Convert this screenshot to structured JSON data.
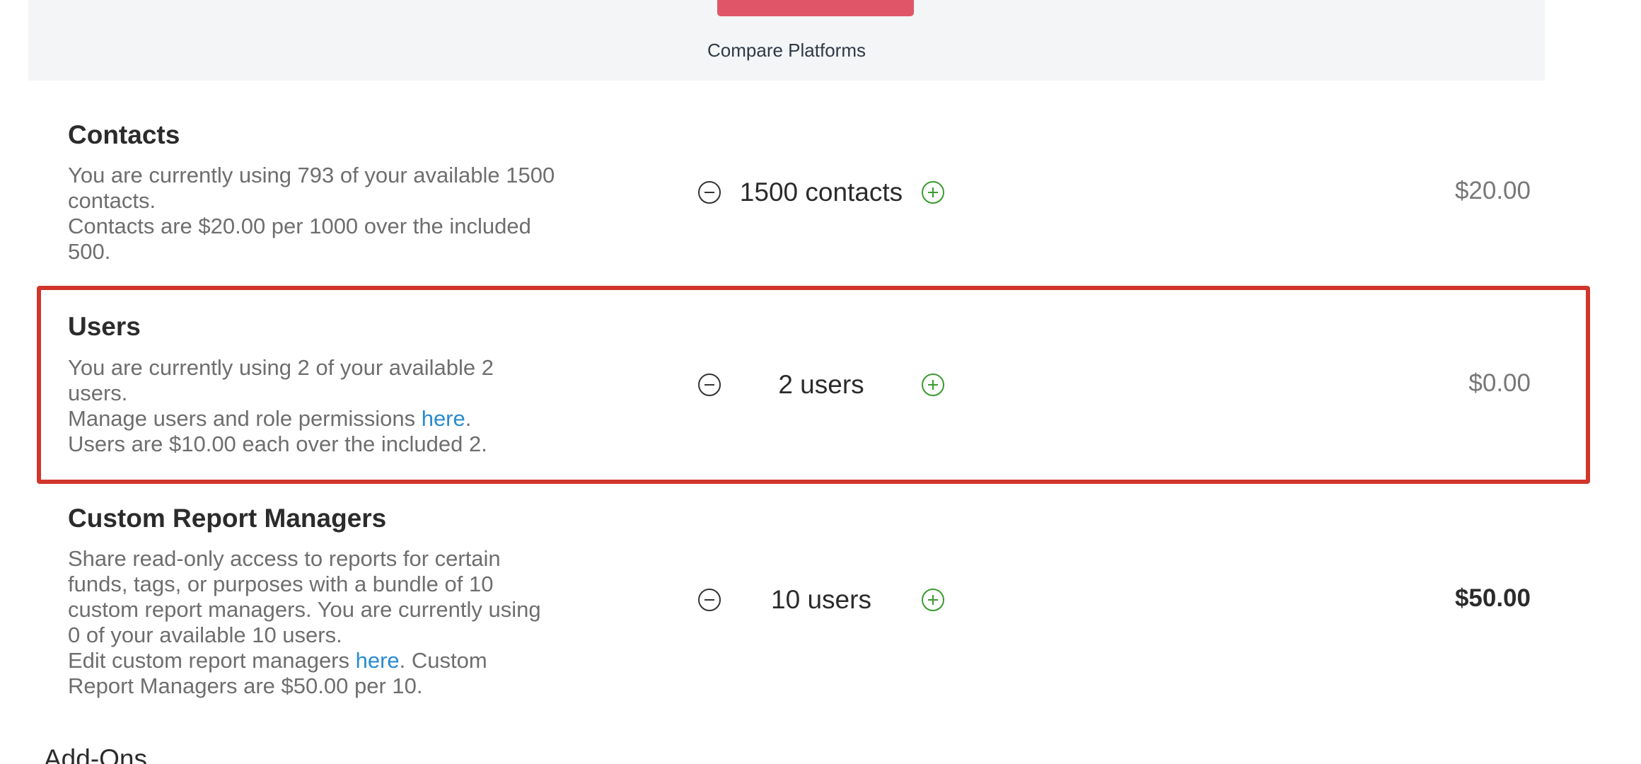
{
  "header": {
    "compare_link": "Compare Platforms"
  },
  "rows": [
    {
      "title": "Contacts",
      "description": [
        "You are currently using 793 of your available 1500 contacts.",
        "Contacts are $20.00 per 1000 over the included 500."
      ],
      "quantity": "1500 contacts",
      "price": "$20.00"
    },
    {
      "title": "Users",
      "description_line1": "You are currently using 2 of your available 2 users.",
      "description_line2_prefix": "Manage users and role permissions ",
      "description_line2_link": "here",
      "description_line2_suffix": ".",
      "description_line3": "Users are $10.00 each over the included 2.",
      "quantity": "2 users",
      "price": "$0.00"
    },
    {
      "title": "Custom Report Managers",
      "description_line1": "Share read-only access to reports for certain funds, tags, or purposes with a bundle of 10 custom report managers. You are currently using 0 of your available 10 users.",
      "description_line2_prefix": "Edit custom report managers ",
      "description_line2_link": "here",
      "description_line2_suffix": ". Custom Report Managers are $50.00 per 10.",
      "quantity": "10 users",
      "price": "$50.00"
    }
  ],
  "addons": {
    "heading": "Add-Ons"
  },
  "colors": {
    "primary_button": "#e05668",
    "link": "#2a8bd0",
    "plus_icon": "#3a9a2f",
    "highlight_border": "#d0362b"
  },
  "icons": {
    "decrement": "minus-circle-icon",
    "increment": "plus-circle-icon"
  }
}
